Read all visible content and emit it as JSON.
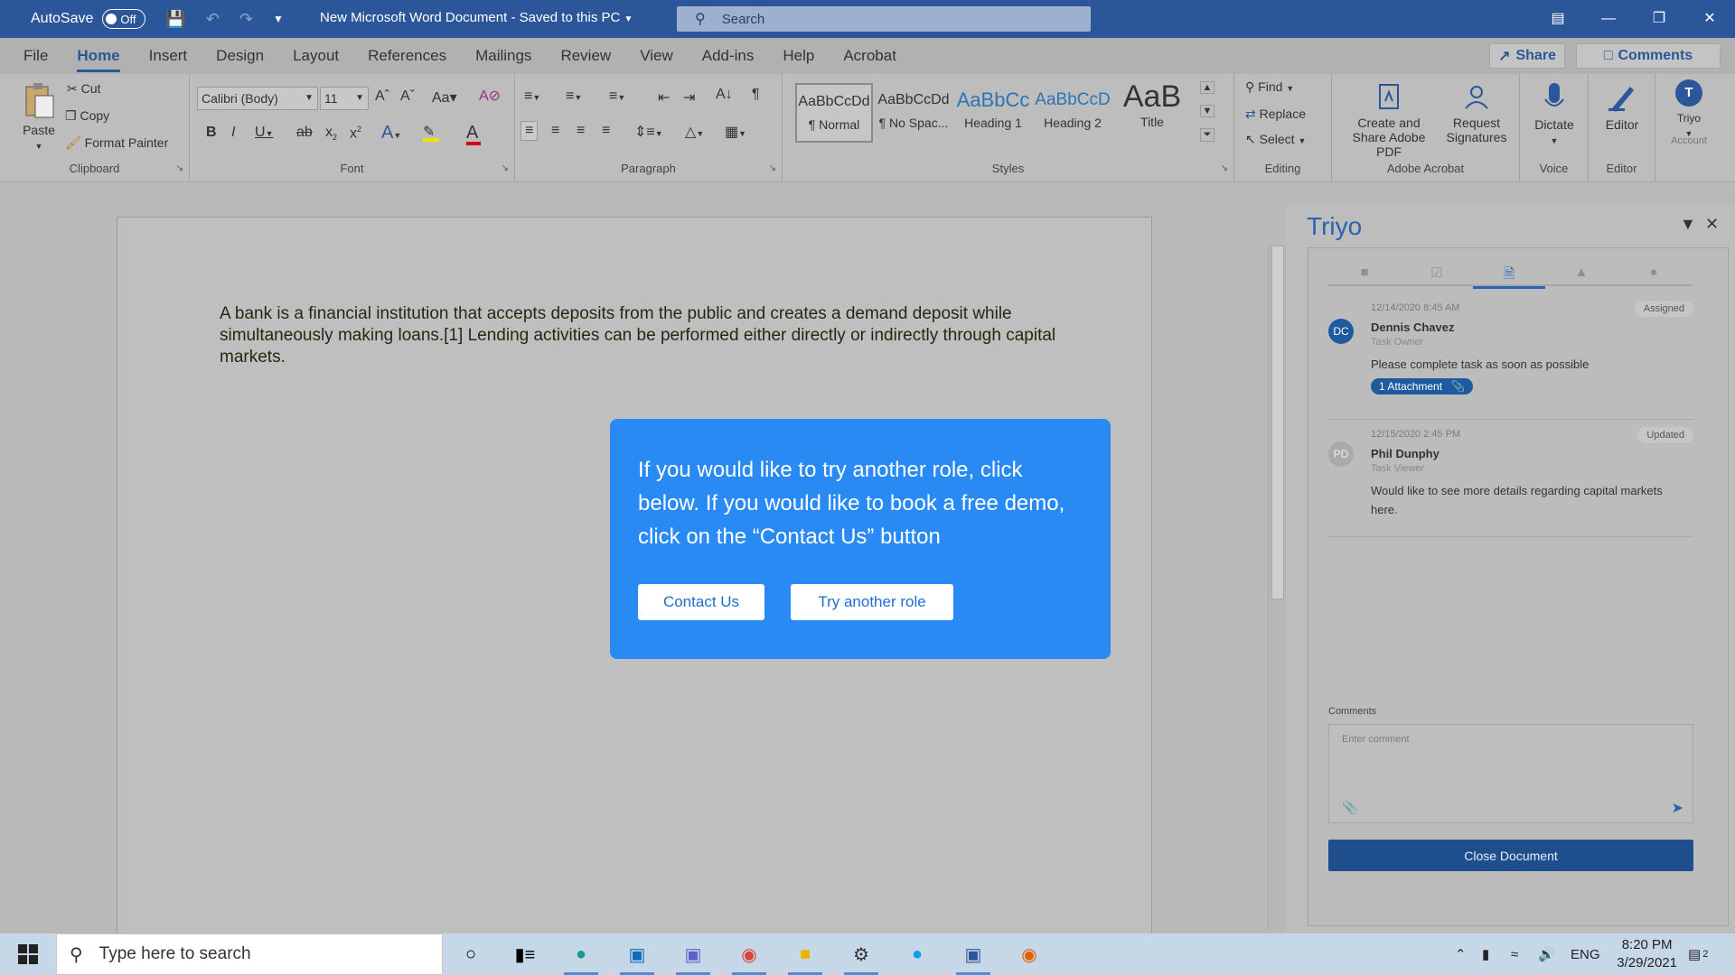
{
  "titlebar": {
    "autosave_label": "AutoSave",
    "autosave_state": "Off",
    "doc_title": "New Microsoft Word Document  -  Saved to this PC",
    "search_placeholder": "Search"
  },
  "ribbon_tabs": [
    "File",
    "Home",
    "Insert",
    "Design",
    "Layout",
    "References",
    "Mailings",
    "Review",
    "View",
    "Add-ins",
    "Help",
    "Acrobat"
  ],
  "share_label": "Share",
  "comments_label": "Comments",
  "clipboard": {
    "paste": "Paste",
    "cut": "Cut",
    "copy": "Copy",
    "format_painter": "Format Painter",
    "group_label": "Clipboard"
  },
  "font": {
    "family": "Calibri (Body)",
    "size": "11",
    "group_label": "Font",
    "color_font": "#d0021b",
    "color_highlight": "#e6e600"
  },
  "paragraph": {
    "group_label": "Paragraph"
  },
  "styles": {
    "group_label": "Styles",
    "items": [
      {
        "sample": "AaBbCcDd",
        "name": "¶ Normal"
      },
      {
        "sample": "AaBbCcDd",
        "name": "¶ No Spac..."
      },
      {
        "sample": "AaBbCc",
        "name": "Heading 1"
      },
      {
        "sample": "AaBbCcD",
        "name": "Heading 2"
      },
      {
        "sample": "AaB",
        "name": "Title"
      }
    ]
  },
  "editing": {
    "find": "Find",
    "replace": "Replace",
    "select": "Select",
    "group_label": "Editing"
  },
  "acrobat": {
    "create": "Create and Share Adobe PDF",
    "request": "Request Signatures",
    "group_label": "Adobe Acrobat"
  },
  "voice": {
    "dictate": "Dictate",
    "group_label": "Voice"
  },
  "editor": {
    "label": "Editor",
    "group_label": "Editor"
  },
  "account": {
    "avatar": "T",
    "name": "Triyo",
    "label": "Account"
  },
  "document": {
    "body": "A bank is a financial institution that accepts deposits from the public and creates a demand deposit while simultaneously making loans.[1] Lending activities can be performed either directly or indirectly through capital markets."
  },
  "modal": {
    "text": "If you would like to try another role, click below. If you would like to book a free demo, click on the “Contact Us” button",
    "contact_label": "Contact Us",
    "try_label": "Try another role",
    "color": "#2a8af4"
  },
  "pane": {
    "title": "Triyo",
    "entries": [
      {
        "date": "12/14/2020  8:45 AM",
        "badge": "Assigned",
        "initials": "DC",
        "name": "Dennis Chavez",
        "role": "Task Owner",
        "message": "Please complete task as soon as possible",
        "attachment": "1 Attachment"
      },
      {
        "date": "12/15/2020  2:45 PM",
        "badge": "Updated",
        "initials": "PD",
        "name": "Phil Dunphy",
        "role": "Task Viewer",
        "message": "Would like to see more details regarding capital markets here."
      }
    ],
    "comments_label": "Comments",
    "comment_placeholder": "Enter comment",
    "close_button": "Close Document"
  },
  "taskbar": {
    "search_placeholder": "Type here to search",
    "apps": [
      "cortana-icon",
      "task-view-icon",
      "edge-icon",
      "outlook-icon",
      "teams-icon",
      "chrome-icon",
      "file-explorer-icon",
      "settings-icon",
      "skype-icon",
      "word-icon",
      "firefox-icon"
    ],
    "language": "ENG",
    "time": "8:20 PM",
    "date": "3/29/2021",
    "notifications": "2"
  }
}
